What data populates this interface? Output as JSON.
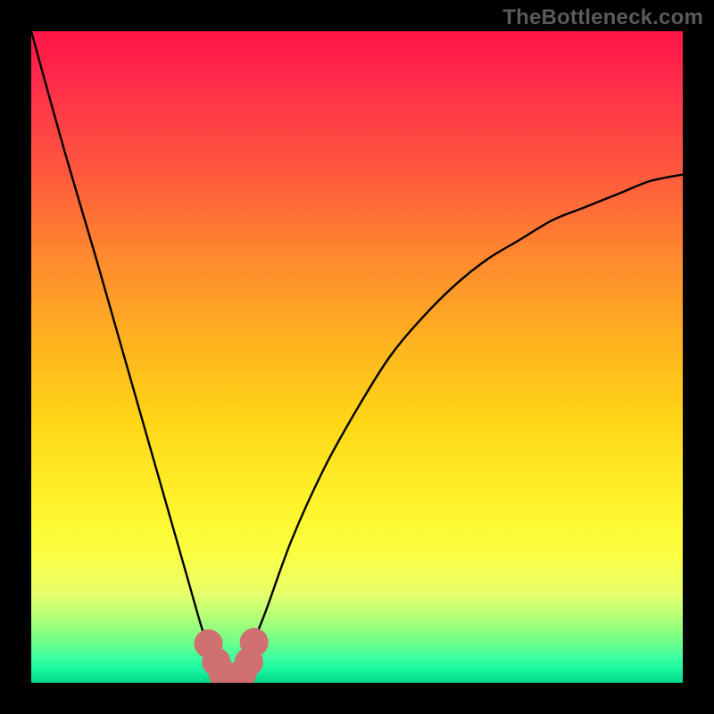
{
  "watermark": "TheBottleneck.com",
  "chart_data": {
    "type": "line",
    "title": "",
    "xlabel": "",
    "ylabel": "",
    "xlim": [
      0,
      100
    ],
    "ylim": [
      0,
      100
    ],
    "grid": false,
    "legend": false,
    "annotations": [],
    "series": [
      {
        "name": "bottleneck-curve",
        "x": [
          0,
          5,
          10,
          14,
          18,
          22,
          24,
          26,
          27,
          28,
          29,
          30,
          31,
          32,
          33,
          34,
          36,
          40,
          45,
          50,
          55,
          60,
          65,
          70,
          75,
          80,
          85,
          90,
          95,
          100
        ],
        "values": [
          100,
          82,
          65,
          51,
          37,
          23,
          16,
          9,
          6,
          3,
          1,
          0,
          0,
          1,
          3,
          6,
          11,
          22,
          33,
          42,
          50,
          56,
          61,
          65,
          68,
          71,
          73,
          75,
          77,
          78
        ]
      }
    ],
    "markers": [
      {
        "x": 27.2,
        "y": 6.0,
        "color": "#d07070",
        "r": 2.2
      },
      {
        "x": 28.4,
        "y": 3.2,
        "color": "#d07070",
        "r": 2.2
      },
      {
        "x": 29.4,
        "y": 1.4,
        "color": "#d07070",
        "r": 2.2
      },
      {
        "x": 30.4,
        "y": 0.6,
        "color": "#d07070",
        "r": 2.2
      },
      {
        "x": 31.4,
        "y": 0.6,
        "color": "#d07070",
        "r": 2.2
      },
      {
        "x": 32.4,
        "y": 1.4,
        "color": "#d07070",
        "r": 2.2
      },
      {
        "x": 33.4,
        "y": 3.2,
        "color": "#d07070",
        "r": 2.2
      },
      {
        "x": 34.2,
        "y": 6.2,
        "color": "#d07070",
        "r": 2.2
      }
    ],
    "gradient_background": {
      "type": "vertical",
      "stops": [
        {
          "pos": 0.0,
          "color": "#ff1447"
        },
        {
          "pos": 0.35,
          "color": "#ff8a2e"
        },
        {
          "pos": 0.72,
          "color": "#fff22a"
        },
        {
          "pos": 1.0,
          "color": "#05d88a"
        }
      ]
    }
  }
}
